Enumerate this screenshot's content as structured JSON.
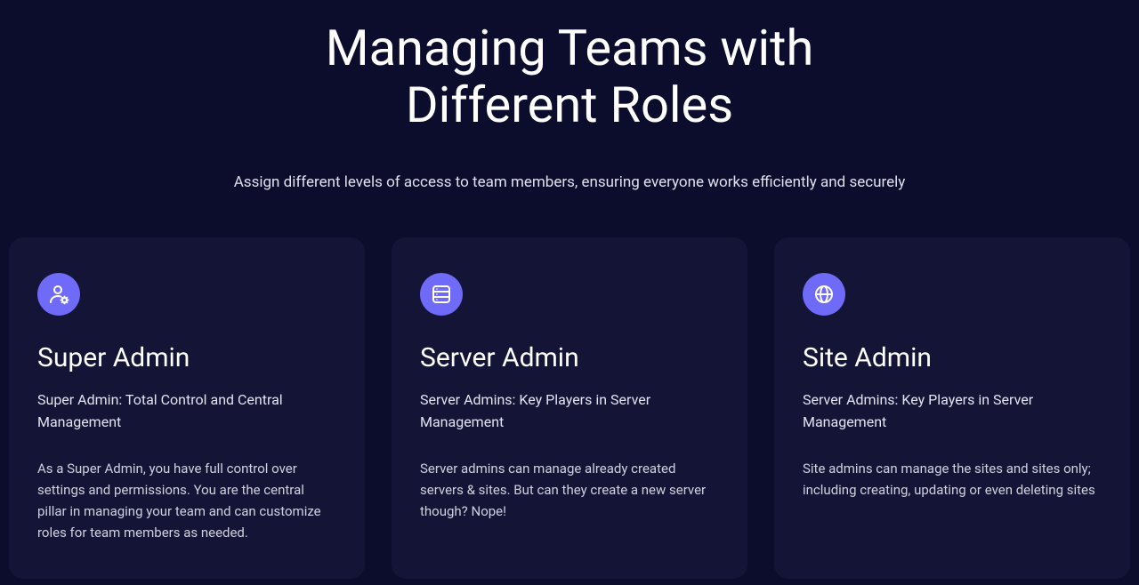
{
  "hero": {
    "title": "Managing Teams with Different Roles",
    "subtitle": "Assign different levels of access to team members, ensuring everyone works efficiently and securely"
  },
  "cards": [
    {
      "icon": "user-settings-icon",
      "title": "Super Admin",
      "subtitle": "Super Admin: Total Control and Central Management",
      "body": "As a Super Admin, you have full control over settings and permissions. You are the central pillar in managing your team and can customize roles for team members as needed."
    },
    {
      "icon": "server-icon",
      "title": "Server Admin",
      "subtitle": "Server Admins: Key Players in Server Management",
      "body": "Server admins can manage already created servers & sites. But can they create a new server though? Nope!"
    },
    {
      "icon": "globe-icon",
      "title": "Site Admin",
      "subtitle": "Server Admins: Key Players in Server Management",
      "body": "Site admins can manage the sites and sites only; including creating, updating or even deleting sites"
    }
  ],
  "colors": {
    "page_bg": "#0c0d2c",
    "card_bg": "#141536",
    "accent": "#6f6af8"
  }
}
